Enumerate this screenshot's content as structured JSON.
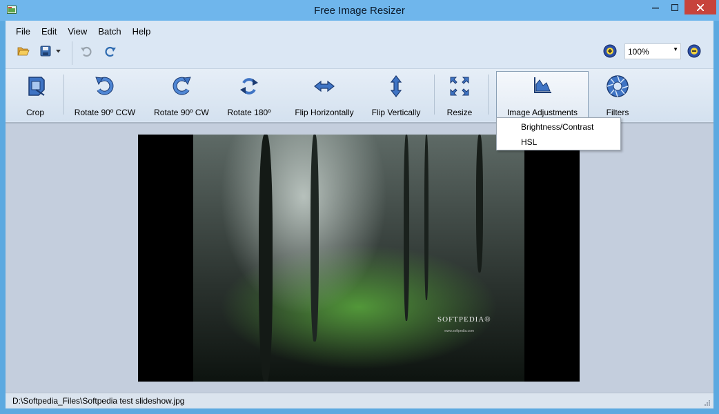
{
  "window": {
    "title": "Free Image Resizer"
  },
  "menu": [
    "File",
    "Edit",
    "View",
    "Batch",
    "Help"
  ],
  "quick_toolbar": {
    "open_icon": "folder-open-icon",
    "save_icon": "save-icon",
    "undo_icon": "undo-icon",
    "redo_icon": "redo-icon"
  },
  "zoom": {
    "value": "100%"
  },
  "ribbon": [
    {
      "label": "Crop",
      "icon": "crop-icon"
    },
    {
      "label": "Rotate 90º CCW",
      "icon": "rotate-ccw-icon"
    },
    {
      "label": "Rotate 90º CW",
      "icon": "rotate-cw-icon"
    },
    {
      "label": "Rotate 180º",
      "icon": "rotate-180-icon"
    },
    {
      "label": "Flip Horizontally",
      "icon": "flip-horizontal-icon"
    },
    {
      "label": "Flip Vertically",
      "icon": "flip-vertical-icon"
    },
    {
      "label": "Resize",
      "icon": "resize-icon"
    },
    {
      "label": "Image Adjustments",
      "icon": "image-adjustments-icon"
    },
    {
      "label": "Filters",
      "icon": "filters-icon"
    }
  ],
  "adjustments_menu": [
    "Brightness/Contrast",
    "HSL"
  ],
  "image": {
    "watermark": "SOFTPEDIA®",
    "watermark_url": "www.softpedia.com"
  },
  "status": {
    "path": "D:\\Softpedia_Files\\Softpedia test slideshow.jpg"
  },
  "colors": {
    "titlebar": "#6fb6ec",
    "close_button": "#c7433b",
    "client": "#dbe7f4",
    "canvas": "#c4cedd"
  }
}
